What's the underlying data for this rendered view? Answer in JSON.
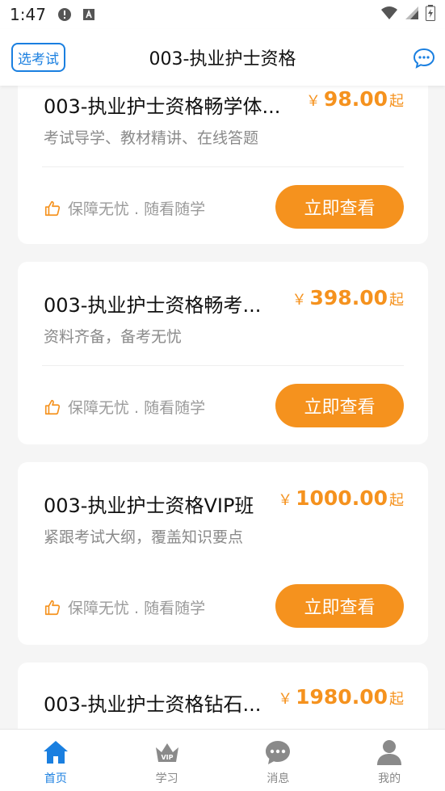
{
  "status": {
    "time": "1:47"
  },
  "header": {
    "choose_label": "选考试",
    "title": "003-执业护士资格"
  },
  "colors": {
    "accent_blue": "#1a7fe0",
    "accent_orange": "#f5921e"
  },
  "cards": [
    {
      "title": "003-执业护士资格畅学体...",
      "yen": "￥",
      "price": "98.00",
      "suffix": "起",
      "desc": "考试导学、教材精讲、在线答题",
      "guarantee": "保障无忧 . 随看随学",
      "button": "立即查看"
    },
    {
      "title": "003-执业护士资格畅考...",
      "yen": "￥",
      "price": "398.00",
      "suffix": "起",
      "desc": "资料齐备，备考无忧",
      "guarantee": "保障无忧 . 随看随学",
      "button": "立即查看"
    },
    {
      "title": "003-执业护士资格VIP班",
      "yen": "￥",
      "price": "1000.00",
      "suffix": "起",
      "desc": "紧跟考试大纲，覆盖知识要点",
      "guarantee": "保障无忧 . 随看随学",
      "button": "立即查看"
    },
    {
      "title": "003-执业护士资格钻石...",
      "yen": "￥",
      "price": "1980.00",
      "suffix": "起"
    }
  ],
  "tabs": [
    {
      "label": "首页",
      "icon": "home-icon"
    },
    {
      "label": "学习",
      "icon": "vip-crown-icon"
    },
    {
      "label": "消息",
      "icon": "chat-icon"
    },
    {
      "label": "我的",
      "icon": "user-icon"
    }
  ]
}
